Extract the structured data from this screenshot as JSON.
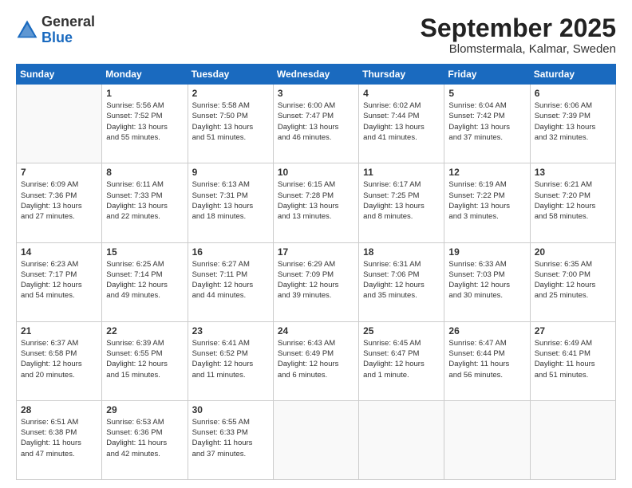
{
  "header": {
    "logo": {
      "general": "General",
      "blue": "Blue"
    },
    "month": "September 2025",
    "location": "Blomstermala, Kalmar, Sweden"
  },
  "weekdays": [
    "Sunday",
    "Monday",
    "Tuesday",
    "Wednesday",
    "Thursday",
    "Friday",
    "Saturday"
  ],
  "weeks": [
    [
      {
        "day": "",
        "info": ""
      },
      {
        "day": "1",
        "info": "Sunrise: 5:56 AM\nSunset: 7:52 PM\nDaylight: 13 hours\nand 55 minutes."
      },
      {
        "day": "2",
        "info": "Sunrise: 5:58 AM\nSunset: 7:50 PM\nDaylight: 13 hours\nand 51 minutes."
      },
      {
        "day": "3",
        "info": "Sunrise: 6:00 AM\nSunset: 7:47 PM\nDaylight: 13 hours\nand 46 minutes."
      },
      {
        "day": "4",
        "info": "Sunrise: 6:02 AM\nSunset: 7:44 PM\nDaylight: 13 hours\nand 41 minutes."
      },
      {
        "day": "5",
        "info": "Sunrise: 6:04 AM\nSunset: 7:42 PM\nDaylight: 13 hours\nand 37 minutes."
      },
      {
        "day": "6",
        "info": "Sunrise: 6:06 AM\nSunset: 7:39 PM\nDaylight: 13 hours\nand 32 minutes."
      }
    ],
    [
      {
        "day": "7",
        "info": "Sunrise: 6:09 AM\nSunset: 7:36 PM\nDaylight: 13 hours\nand 27 minutes."
      },
      {
        "day": "8",
        "info": "Sunrise: 6:11 AM\nSunset: 7:33 PM\nDaylight: 13 hours\nand 22 minutes."
      },
      {
        "day": "9",
        "info": "Sunrise: 6:13 AM\nSunset: 7:31 PM\nDaylight: 13 hours\nand 18 minutes."
      },
      {
        "day": "10",
        "info": "Sunrise: 6:15 AM\nSunset: 7:28 PM\nDaylight: 13 hours\nand 13 minutes."
      },
      {
        "day": "11",
        "info": "Sunrise: 6:17 AM\nSunset: 7:25 PM\nDaylight: 13 hours\nand 8 minutes."
      },
      {
        "day": "12",
        "info": "Sunrise: 6:19 AM\nSunset: 7:22 PM\nDaylight: 13 hours\nand 3 minutes."
      },
      {
        "day": "13",
        "info": "Sunrise: 6:21 AM\nSunset: 7:20 PM\nDaylight: 12 hours\nand 58 minutes."
      }
    ],
    [
      {
        "day": "14",
        "info": "Sunrise: 6:23 AM\nSunset: 7:17 PM\nDaylight: 12 hours\nand 54 minutes."
      },
      {
        "day": "15",
        "info": "Sunrise: 6:25 AM\nSunset: 7:14 PM\nDaylight: 12 hours\nand 49 minutes."
      },
      {
        "day": "16",
        "info": "Sunrise: 6:27 AM\nSunset: 7:11 PM\nDaylight: 12 hours\nand 44 minutes."
      },
      {
        "day": "17",
        "info": "Sunrise: 6:29 AM\nSunset: 7:09 PM\nDaylight: 12 hours\nand 39 minutes."
      },
      {
        "day": "18",
        "info": "Sunrise: 6:31 AM\nSunset: 7:06 PM\nDaylight: 12 hours\nand 35 minutes."
      },
      {
        "day": "19",
        "info": "Sunrise: 6:33 AM\nSunset: 7:03 PM\nDaylight: 12 hours\nand 30 minutes."
      },
      {
        "day": "20",
        "info": "Sunrise: 6:35 AM\nSunset: 7:00 PM\nDaylight: 12 hours\nand 25 minutes."
      }
    ],
    [
      {
        "day": "21",
        "info": "Sunrise: 6:37 AM\nSunset: 6:58 PM\nDaylight: 12 hours\nand 20 minutes."
      },
      {
        "day": "22",
        "info": "Sunrise: 6:39 AM\nSunset: 6:55 PM\nDaylight: 12 hours\nand 15 minutes."
      },
      {
        "day": "23",
        "info": "Sunrise: 6:41 AM\nSunset: 6:52 PM\nDaylight: 12 hours\nand 11 minutes."
      },
      {
        "day": "24",
        "info": "Sunrise: 6:43 AM\nSunset: 6:49 PM\nDaylight: 12 hours\nand 6 minutes."
      },
      {
        "day": "25",
        "info": "Sunrise: 6:45 AM\nSunset: 6:47 PM\nDaylight: 12 hours\nand 1 minute."
      },
      {
        "day": "26",
        "info": "Sunrise: 6:47 AM\nSunset: 6:44 PM\nDaylight: 11 hours\nand 56 minutes."
      },
      {
        "day": "27",
        "info": "Sunrise: 6:49 AM\nSunset: 6:41 PM\nDaylight: 11 hours\nand 51 minutes."
      }
    ],
    [
      {
        "day": "28",
        "info": "Sunrise: 6:51 AM\nSunset: 6:38 PM\nDaylight: 11 hours\nand 47 minutes."
      },
      {
        "day": "29",
        "info": "Sunrise: 6:53 AM\nSunset: 6:36 PM\nDaylight: 11 hours\nand 42 minutes."
      },
      {
        "day": "30",
        "info": "Sunrise: 6:55 AM\nSunset: 6:33 PM\nDaylight: 11 hours\nand 37 minutes."
      },
      {
        "day": "",
        "info": ""
      },
      {
        "day": "",
        "info": ""
      },
      {
        "day": "",
        "info": ""
      },
      {
        "day": "",
        "info": ""
      }
    ]
  ]
}
